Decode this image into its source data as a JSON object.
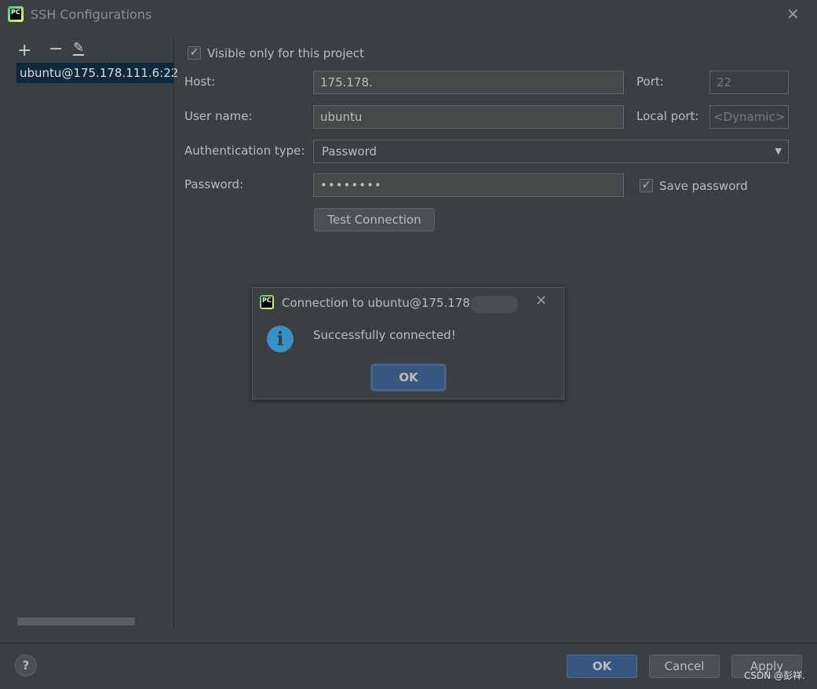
{
  "window": {
    "title": "SSH Configurations"
  },
  "sidebar": {
    "items": [
      {
        "label": "ubuntu@175.178.111.6:22",
        "selected": true
      }
    ]
  },
  "form": {
    "visible_only_label": "Visible only for this project",
    "visible_only_checked": true,
    "host_label": "Host:",
    "host_value": "175.178.",
    "port_label": "Port:",
    "port_value": "22",
    "username_label": "User name:",
    "username_value": "ubuntu",
    "local_port_label": "Local port:",
    "local_port_placeholder": "<Dynamic>",
    "auth_label": "Authentication type:",
    "auth_value": "Password",
    "password_label": "Password:",
    "password_value": "••••••••",
    "save_password_label": "Save password",
    "save_password_checked": true,
    "test_connection_label": "Test Connection"
  },
  "popup": {
    "title": "Connection to ubuntu@175.178.",
    "message": "Successfully connected!",
    "ok_label": "OK"
  },
  "footer": {
    "help": "?",
    "ok_label": "OK",
    "cancel_label": "Cancel",
    "apply_label": "Apply"
  },
  "watermark": "CSDN @彭祥.",
  "colors": {
    "background": "#3c3f41",
    "selection": "#0d293e",
    "default_button": "#365880",
    "info": "#3592c4"
  }
}
